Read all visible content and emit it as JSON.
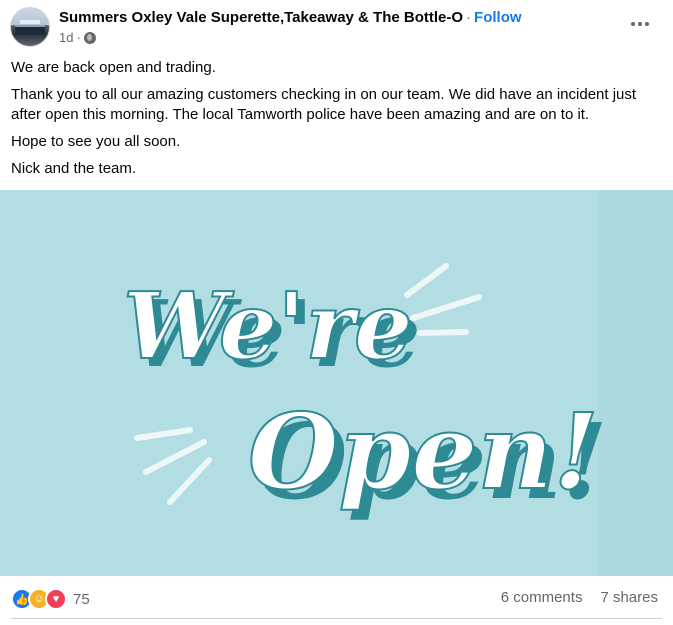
{
  "post": {
    "page_name": "Summers Oxley Vale Superette,Takeaway & The Bottle-O",
    "separator": "·",
    "follow_label": "Follow",
    "time": "1d",
    "time_separator": "·",
    "privacy_icon": "globe-icon",
    "menu_icon": "more-options-icon",
    "paragraphs": [
      "We are back open and trading.",
      "Thank you to all our amazing customers checking in on our team.  We did have an incident just after open this morning.  The local Tamworth police have been amazing and are on to it.",
      "Hope to see you all soon.",
      "Nick and the team."
    ],
    "image": {
      "line1": "We're",
      "line2": "Open!",
      "background": "#b2dde3",
      "letter_fill": "#ffffff",
      "letter_shadow": "#2e8b96"
    },
    "reactions": {
      "icons": [
        "like-icon",
        "care-icon",
        "love-icon"
      ],
      "count": "75"
    },
    "comments": "6 comments",
    "shares": "7 shares"
  }
}
